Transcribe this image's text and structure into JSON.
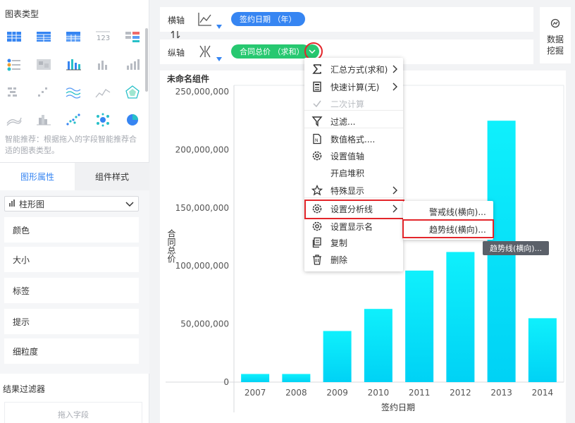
{
  "left_panel": {
    "chart_types_title": "图表类型",
    "chart_type_icons": [
      "table-icon",
      "cross-table-icon",
      "grouped-table-icon",
      "number-card-icon",
      "kpi-table-icon",
      "dot-matrix-icon",
      "heatmap-icon",
      "stacked-bar-icon",
      "bar-chart-icon",
      "column-chart-icon",
      "gantt-icon",
      "scatter-grid-icon",
      "multi-line-icon",
      "line-chart-icon",
      "radar-icon",
      "area-chart-icon",
      "histogram-icon",
      "scatter-icon",
      "bubble-icon",
      "pie-chart-icon"
    ],
    "recommend_text": "智能推荐：根据拖入的字段智能推荐合适的图表类型。",
    "tabs": [
      "图形属性",
      "组件样式"
    ],
    "chart_select_value": "柱形图",
    "properties": [
      "颜色",
      "大小",
      "标签",
      "提示",
      "细粒度"
    ],
    "filter_title": "结果过滤器",
    "drop_field_placeholder": "拖入字段"
  },
  "axis": {
    "x_label": "横轴",
    "x_pill": "签约日期 （年）",
    "y_label": "纵轴",
    "y_pill": "合同总价 （求和）"
  },
  "mining": {
    "line1": "数据",
    "line2": "挖掘"
  },
  "widget_title": "未命名组件",
  "context_menu": {
    "items": [
      {
        "label": "汇总方式(求和)",
        "icon": "sigma-icon",
        "has_sub": true,
        "disabled": false
      },
      {
        "label": "快速计算(无)",
        "icon": "calculator-icon",
        "has_sub": true,
        "disabled": false
      },
      {
        "label": "二次计算",
        "icon": "check-icon",
        "has_sub": false,
        "disabled": true
      },
      {
        "label": "过滤...",
        "icon": "filter-icon",
        "has_sub": false,
        "disabled": false
      },
      {
        "label": "数值格式....",
        "icon": "number-format-icon",
        "has_sub": false,
        "disabled": false
      },
      {
        "label": "设置值轴",
        "icon": "gear-icon",
        "has_sub": false,
        "disabled": false
      },
      {
        "label": "开启堆积",
        "icon": "",
        "has_sub": false,
        "disabled": false
      },
      {
        "label": "特殊显示",
        "icon": "star-icon",
        "has_sub": true,
        "disabled": false
      },
      {
        "label": "设置分析线",
        "icon": "gear-icon",
        "has_sub": true,
        "disabled": false
      },
      {
        "label": "设置显示名",
        "icon": "gear-icon",
        "has_sub": false,
        "disabled": false
      },
      {
        "label": "复制",
        "icon": "copy-icon",
        "has_sub": false,
        "disabled": false
      },
      {
        "label": "删除",
        "icon": "trash-icon",
        "has_sub": false,
        "disabled": false
      }
    ]
  },
  "sub_menu": {
    "items": [
      "警戒线(横向)...",
      "趋势线(横向)..."
    ]
  },
  "tooltip": "趋势线(横向)...",
  "colors": {
    "accent": "#3685f2",
    "measure_pill": "#27c870",
    "bar_top": "#0ff0fc",
    "bar_bottom": "#00d2f5",
    "highlight": "#e3262b"
  },
  "chart_data": {
    "type": "bar",
    "categories": [
      "2007",
      "2008",
      "2009",
      "2010",
      "2011",
      "2012",
      "2013",
      "2014"
    ],
    "values": [
      7000000,
      7000000,
      44000000,
      63000000,
      96000000,
      112000000,
      225000000,
      55000000
    ],
    "xlabel": "签约日期",
    "ylabel": "合同总价",
    "ylim": [
      0,
      250000000
    ],
    "y_ticks": [
      "0",
      "50,000,000",
      "100,000,000",
      "150,000,000",
      "200,000,000",
      "250,000,000"
    ],
    "grid": false
  }
}
